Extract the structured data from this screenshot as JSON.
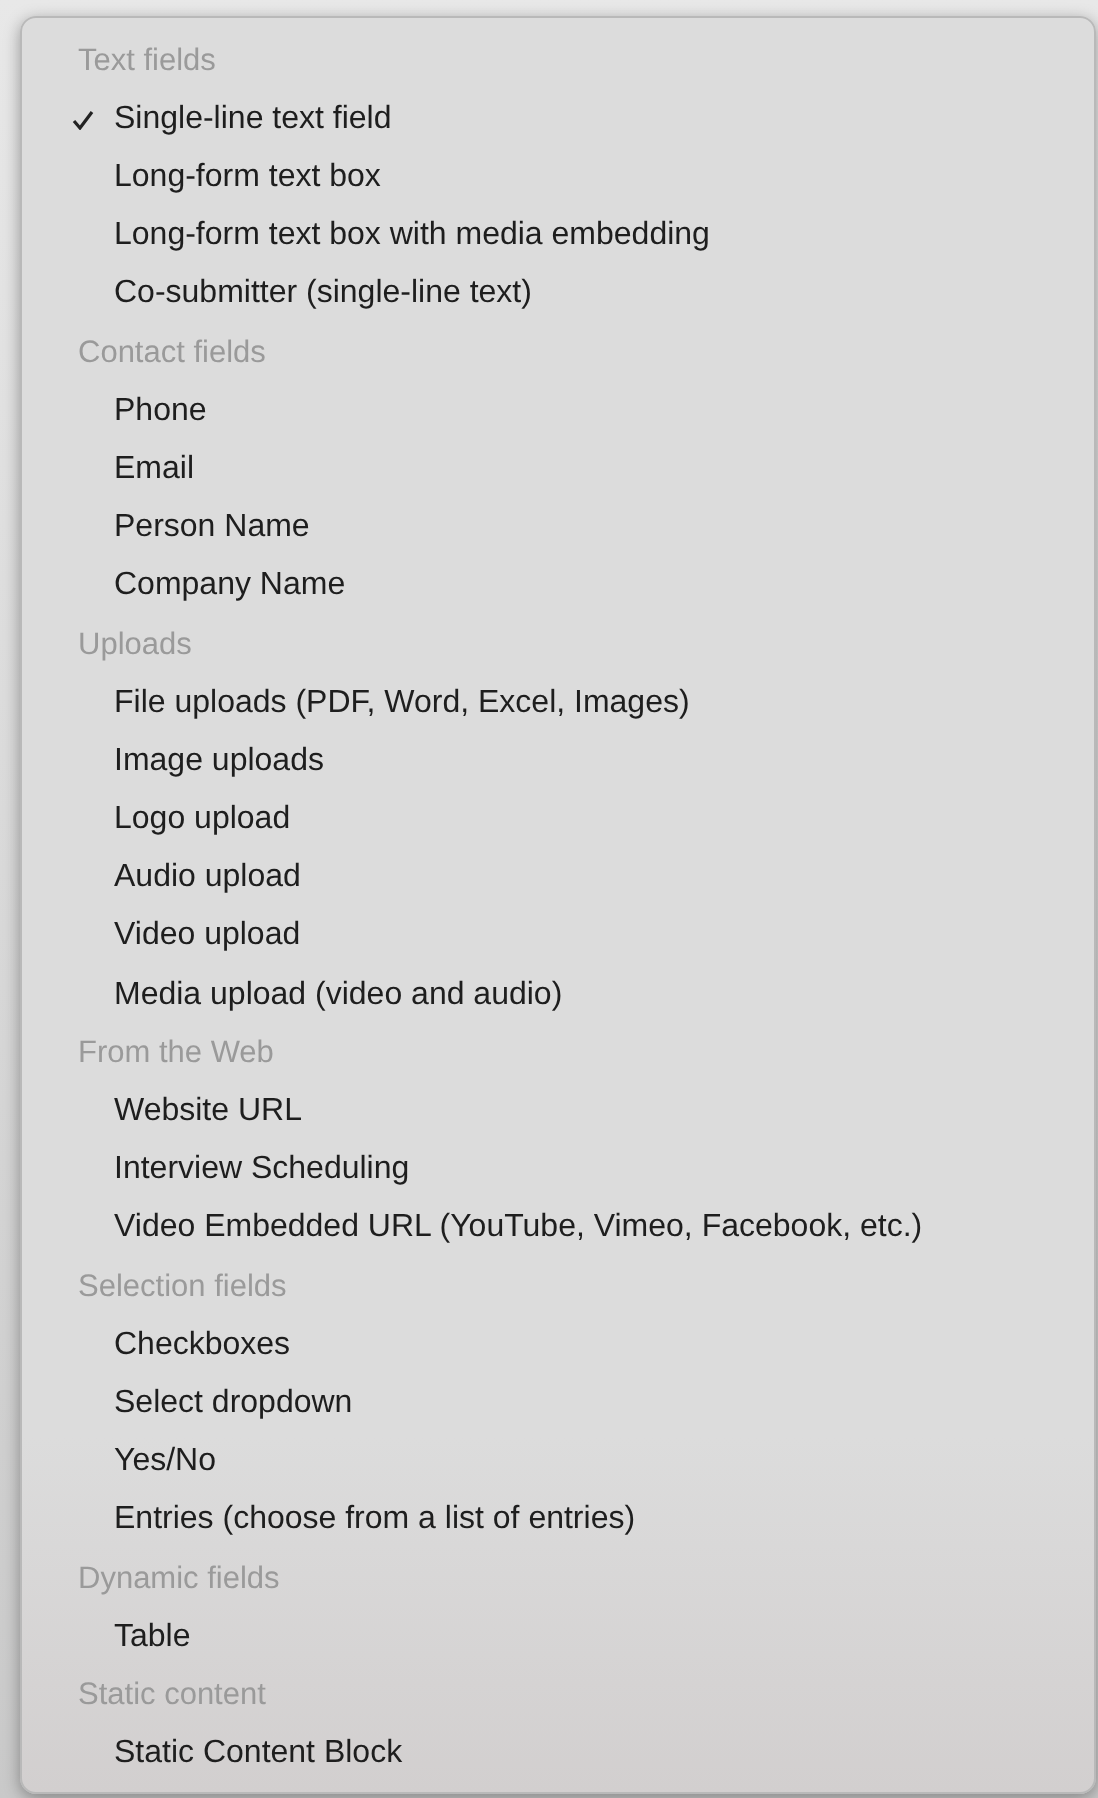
{
  "menu": {
    "groups": [
      {
        "header": "Text fields",
        "items": [
          {
            "label": "Single-line text field",
            "checked": true
          },
          {
            "label": "Long-form text box",
            "checked": false
          },
          {
            "label": "Long-form text box with media embedding",
            "checked": false
          },
          {
            "label": "Co-submitter (single-line text)",
            "checked": false
          }
        ]
      },
      {
        "header": "Contact fields",
        "items": [
          {
            "label": "Phone",
            "checked": false
          },
          {
            "label": "Email",
            "checked": false
          },
          {
            "label": "Person Name",
            "checked": false
          },
          {
            "label": "Company Name",
            "checked": false
          }
        ]
      },
      {
        "header": "Uploads",
        "items": [
          {
            "label": "File uploads (PDF, Word, Excel, Images)",
            "checked": false
          },
          {
            "label": "Image uploads",
            "checked": false
          },
          {
            "label": "Logo upload",
            "checked": false
          },
          {
            "label": "Audio upload",
            "checked": false
          },
          {
            "label": "Video upload",
            "checked": false
          },
          {
            "label": "Media upload (video and audio)",
            "checked": false
          }
        ]
      },
      {
        "header": "From the Web",
        "items": [
          {
            "label": "Website URL",
            "checked": false
          },
          {
            "label": "Interview Scheduling",
            "checked": false
          },
          {
            "label": "Video Embedded URL (YouTube, Vimeo, Facebook, etc.)",
            "checked": false
          }
        ]
      },
      {
        "header": "Selection fields",
        "items": [
          {
            "label": "Checkboxes",
            "checked": false
          },
          {
            "label": "Select dropdown",
            "checked": false
          },
          {
            "label": "Yes/No",
            "checked": false
          },
          {
            "label": "Entries (choose from a list of entries)",
            "checked": false
          }
        ]
      },
      {
        "header": "Dynamic fields",
        "items": [
          {
            "label": "Table",
            "checked": false
          }
        ]
      },
      {
        "header": "Static content",
        "items": [
          {
            "label": "Static Content Block",
            "checked": false
          }
        ]
      }
    ]
  }
}
